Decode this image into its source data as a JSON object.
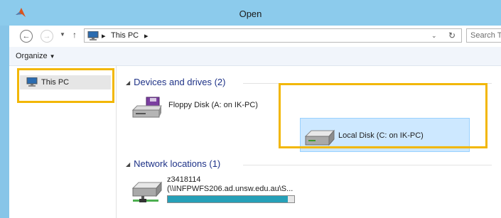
{
  "window": {
    "title": "Open"
  },
  "address": {
    "crumbs": [
      "This PC"
    ],
    "separator": "▸",
    "search_placeholder": "Search T"
  },
  "toolbar": {
    "organize_label": "Organize"
  },
  "navpane": {
    "items": [
      {
        "label": "This PC",
        "icon": "computer-icon"
      }
    ]
  },
  "groups": [
    {
      "header": "Devices and drives (2)",
      "items": [
        {
          "label": "Floppy Disk (A: on IK-PC)",
          "icon": "floppy-drive-icon",
          "selected": false
        },
        {
          "label": "Local Disk (C: on IK-PC)",
          "icon": "hard-drive-icon",
          "selected": true
        }
      ]
    },
    {
      "header": "Network locations (1)",
      "items": [
        {
          "label": "z3418114",
          "sublabel": "(\\\\INFPWFS206.ad.unsw.edu.au\\S...",
          "icon": "network-drive-icon",
          "usage_fraction": 0.95
        }
      ]
    }
  ],
  "colors": {
    "accent": "#87c5e8",
    "selection": "#cde8ff",
    "highlight": "#f2b705",
    "progress": "#26a0b8"
  }
}
